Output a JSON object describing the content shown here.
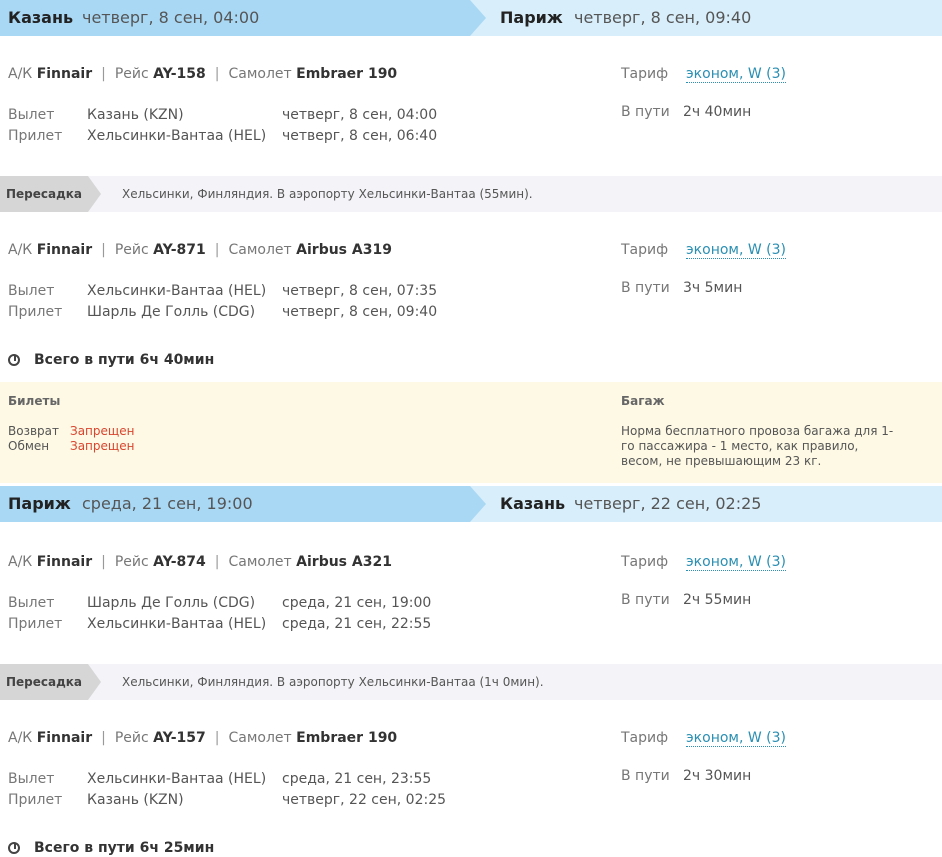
{
  "routes": [
    {
      "from_city": "Казань",
      "from_time": "четверг, 8 сен, 04:00",
      "to_city": "Париж",
      "to_time": "четверг, 8 сен, 09:40"
    },
    {
      "from_city": "Париж",
      "from_time": "среда, 21 сен, 19:00",
      "to_city": "Казань",
      "to_time": "четверг, 22 сен, 02:25"
    }
  ],
  "labels": {
    "airline": "А/К",
    "flight": "Рейс",
    "aircraft": "Самолет",
    "departure": "Вылет",
    "arrival": "Прилет",
    "tariff": "Тариф",
    "in_transit": "В пути",
    "transfer": "Пересадка"
  },
  "segments": [
    {
      "airline": "Finnair",
      "flight": "AY-158",
      "aircraft": "Embraer 190",
      "dep_airport": "Казань (KZN)",
      "dep_time": "четверг, 8 сен, 04:00",
      "arr_airport": "Хельсинки-Вантаа (HEL)",
      "arr_time": "четверг, 8 сен, 06:40",
      "tariff": "эконом, W (3)",
      "duration": "2ч 40мин"
    },
    {
      "airline": "Finnair",
      "flight": "AY-871",
      "aircraft": "Airbus A319",
      "dep_airport": "Хельсинки-Вантаа (HEL)",
      "dep_time": "четверг, 8 сен, 07:35",
      "arr_airport": "Шарль Де Голль (CDG)",
      "arr_time": "четверг, 8 сен, 09:40",
      "tariff": "эконом, W (3)",
      "duration": "3ч 5мин"
    },
    {
      "airline": "Finnair",
      "flight": "AY-874",
      "aircraft": "Airbus A321",
      "dep_airport": "Шарль Де Голль (CDG)",
      "dep_time": "среда, 21 сен, 19:00",
      "arr_airport": "Хельсинки-Вантаа (HEL)",
      "arr_time": "среда, 21 сен, 22:55",
      "tariff": "эконом, W (3)",
      "duration": "2ч 55мин"
    },
    {
      "airline": "Finnair",
      "flight": "AY-157",
      "aircraft": "Embraer 190",
      "dep_airport": "Хельсинки-Вантаа (HEL)",
      "dep_time": "среда, 21 сен, 23:55",
      "arr_airport": "Казань (KZN)",
      "arr_time": "четверг, 22 сен, 02:25",
      "tariff": "эконом, W (3)",
      "duration": "2ч 30мин"
    }
  ],
  "transfers": [
    "Хельсинки, Финляндия. В аэропорту Хельсинки-Вантаа (55мин).",
    "Хельсинки, Финляндия. В аэропорту Хельсинки-Вантаа (1ч 0мин)."
  ],
  "totals": [
    "Всего в пути 6ч 40мин",
    "Всего в пути 6ч 25мин"
  ],
  "rules": {
    "tickets_title": "Билеты",
    "refund_label": "Возврат",
    "refund_value": "Запрещен",
    "exchange_label": "Обмен",
    "exchange_value": "Запрещен",
    "baggage_title": "Багаж",
    "baggage_text": "Норма бесплатного провоза багажа для 1-го пассажира - 1 место, как правило, весом, не превышающим 23 кг."
  },
  "colors": {
    "route_band": "#a9d8f5",
    "route_band_light": "#d8eefa",
    "link": "#2a8fb3",
    "forbidden": "#d9452e",
    "rules_bg": "#fdf9e5"
  }
}
